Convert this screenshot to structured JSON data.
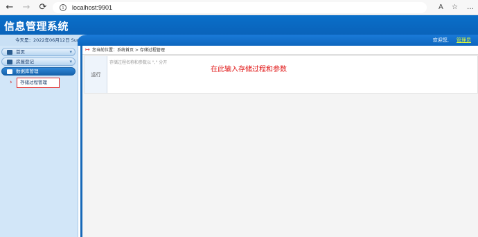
{
  "browser": {
    "url": "localhost:9901",
    "back": "←",
    "forward": "→",
    "reload": "⟳",
    "info": "i",
    "read_aloud": "A",
    "favorites": "☆",
    "more": "…"
  },
  "header": {
    "title": "信息管理系统"
  },
  "status": {
    "date": "今天是：2022年06月12日 Sun",
    "welcome": "欢迎您,",
    "user": "管理员"
  },
  "sidebar": {
    "items": [
      {
        "label": "首页"
      },
      {
        "label": "房屋登记"
      },
      {
        "label": "数据库管理"
      }
    ],
    "submenu": {
      "label": "存储过程管理"
    }
  },
  "main": {
    "breadcrumb": "您当前位置：系统首页 > 存储过程管理",
    "run_label": "运行",
    "input_placeholder": "存储过程名称和参数以 \",\" 分开",
    "hint": "在此输入存储过程和参数"
  },
  "colors": {
    "brand": "#0a6fc9",
    "hint": "#e01515",
    "admin": "#eaff30"
  }
}
